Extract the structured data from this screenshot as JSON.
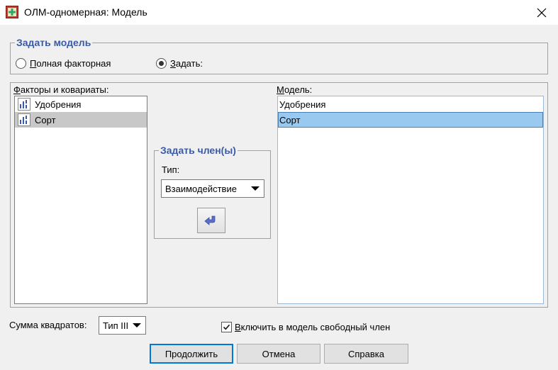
{
  "window": {
    "title": "ОЛМ-одномерная: Модель"
  },
  "specify_model": {
    "legend": "Задать модель",
    "radio_full": {
      "label_prefix": "П",
      "label_rest": "олная факторная",
      "checked": false
    },
    "radio_custom": {
      "label_prefix": "З",
      "label_rest": "адать:",
      "checked": true
    }
  },
  "factors": {
    "label_prefix": "Ф",
    "label_rest": "акторы и ковариаты:",
    "items": [
      "Удобрения",
      "Сорт"
    ]
  },
  "build_term": {
    "legend": "Задать член(ы)",
    "type_label": "Тип:",
    "type_value": "Взаимодействие"
  },
  "model": {
    "label_prefix": "М",
    "label_rest": "одель:",
    "items": [
      "Удобрения",
      "Сорт"
    ]
  },
  "sum_of_squares": {
    "label": "Сумма квадратов:",
    "value": "Тип III"
  },
  "include_intercept": {
    "label_prefix": "В",
    "label_rest": "ключить в модель свободный член",
    "checked": true
  },
  "buttons": {
    "continue": "Продолжить",
    "cancel": "Отмена",
    "help": "Справка"
  },
  "colors": {
    "legend_blue": "#3a5aa8",
    "selection_blue": "#99c9ef",
    "selection_gray": "#c8c8c8"
  }
}
